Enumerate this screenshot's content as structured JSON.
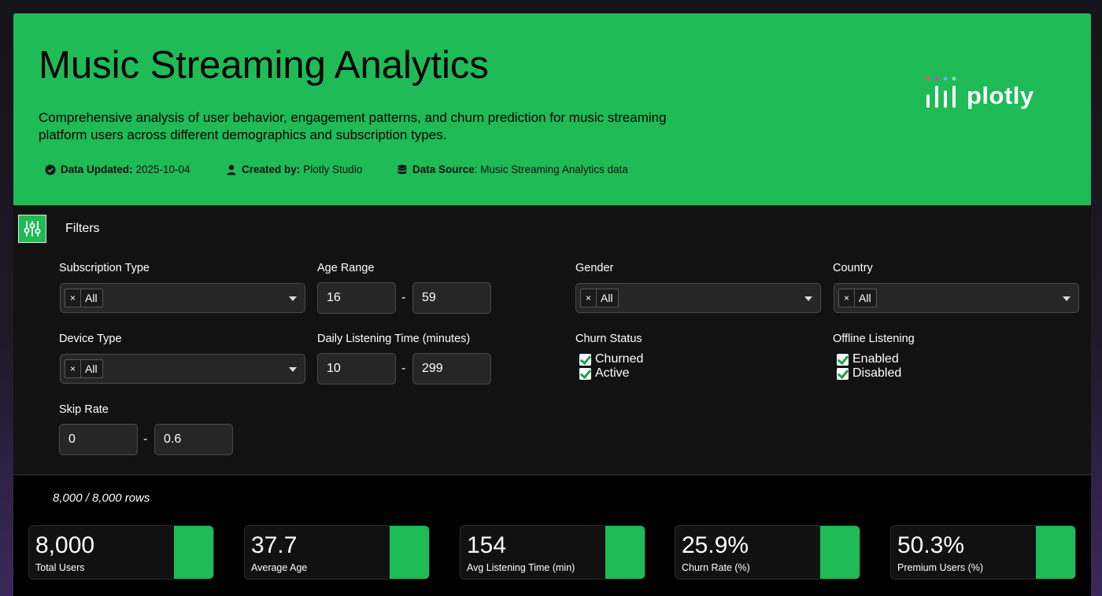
{
  "header": {
    "title": "Music Streaming Analytics",
    "subtitle": "Comprehensive analysis of user behavior, engagement patterns, and churn prediction for music streaming platform users across different demographics and subscription types.",
    "meta": {
      "updated_label": "Data Updated:",
      "updated_value": "2025-10-04",
      "created_label": "Created by:",
      "created_value": "Plotly Studio",
      "source_label": "Data Source",
      "source_value": ": Music Streaming Analytics data"
    },
    "logo_text": "plotly"
  },
  "filters": {
    "title": "Filters",
    "subscription_type": {
      "label": "Subscription Type",
      "chip": "All"
    },
    "age_range": {
      "label": "Age Range",
      "min": "16",
      "max": "59"
    },
    "gender": {
      "label": "Gender",
      "chip": "All"
    },
    "country": {
      "label": "Country",
      "chip": "All"
    },
    "device_type": {
      "label": "Device Type",
      "chip": "All"
    },
    "listening_time": {
      "label": "Daily Listening Time (minutes)",
      "min": "10",
      "max": "299"
    },
    "churn_status": {
      "label": "Churn Status",
      "options": [
        "Churned",
        "Active"
      ]
    },
    "offline_listening": {
      "label": "Offline Listening",
      "options": [
        "Enabled",
        "Disabled"
      ]
    },
    "skip_rate": {
      "label": "Skip Rate",
      "min": "0",
      "max": "0.6"
    },
    "dash": "-",
    "chip_remove": "×"
  },
  "rows_text": "8,000 / 8,000 rows",
  "kpis": [
    {
      "value": "8,000",
      "label": "Total Users"
    },
    {
      "value": "37.7",
      "label": "Average Age"
    },
    {
      "value": "154",
      "label": "Avg Listening Time (min)"
    },
    {
      "value": "25.9%",
      "label": "Churn Rate (%)"
    },
    {
      "value": "50.3%",
      "label": "Premium Users (%)"
    }
  ],
  "colors": {
    "accent": "#1ebb57",
    "background": "#121212"
  }
}
